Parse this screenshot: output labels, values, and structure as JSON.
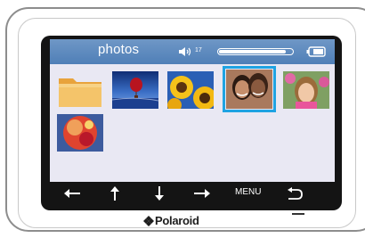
{
  "screen": {
    "title": "photos",
    "volume": "17",
    "progress_fraction": 0.92
  },
  "icons": {
    "speaker": "speaker-icon",
    "battery": "battery-icon",
    "folder": "folder-icon"
  },
  "thumbnails": [
    {
      "type": "folder",
      "name": "folder-icon"
    },
    {
      "type": "photo",
      "subject": "hot air balloon over water"
    },
    {
      "type": "photo",
      "subject": "sunflowers"
    },
    {
      "type": "photo",
      "subject": "two smiling women",
      "selected": true
    },
    {
      "type": "photo",
      "subject": "girl in pink"
    },
    {
      "type": "photo",
      "subject": "red abstract"
    }
  ],
  "nav": {
    "left": "left-arrow-icon",
    "up": "up-arrow-icon",
    "down": "down-arrow-icon",
    "right": "right-arrow-icon",
    "menu_label": "MENU",
    "back": "back-arrow-icon"
  },
  "brand": {
    "name": "Polaroid"
  },
  "colors": {
    "topbar": "#5b89bf",
    "screen_bg": "#e9e8f3",
    "selection": "#1fa3e2",
    "bottombar": "#141414"
  }
}
